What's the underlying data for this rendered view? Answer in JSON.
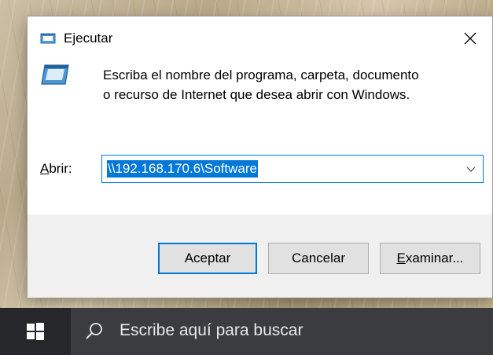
{
  "dialog": {
    "title": "Ejecutar",
    "description_line1": "Escriba el nombre del programa, carpeta, documento",
    "description_line2": "o recurso de Internet que desea abrir con Windows.",
    "open_label_accel": "A",
    "open_label_rest": "brir:",
    "open_value": "\\\\192.168.170.6\\Software",
    "ok_label": "Aceptar",
    "cancel_label": "Cancelar",
    "browse_accel": "E",
    "browse_rest": "xaminar...",
    "icons": {
      "title": "run-icon",
      "big": "run-icon",
      "close": "close-icon",
      "dropdown": "chevron-down-icon"
    }
  },
  "taskbar": {
    "search_placeholder": "Escribe aquí para buscar",
    "icons": {
      "start": "windows-logo-icon",
      "search": "search-icon"
    }
  },
  "colors": {
    "accent": "#0078d7",
    "taskbar": "#25272a",
    "search_box": "#3a3c3f"
  }
}
